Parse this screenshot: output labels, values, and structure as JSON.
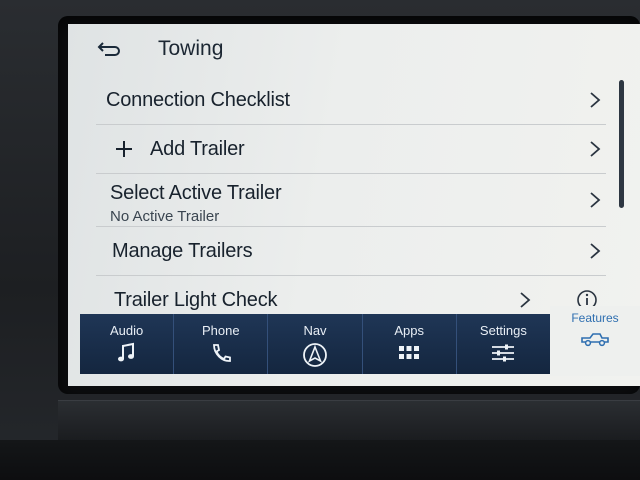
{
  "header": {
    "title": "Towing"
  },
  "menu": [
    {
      "label": "Connection Checklist"
    },
    {
      "label": "Add Trailer"
    },
    {
      "label": "Select Active Trailer",
      "sub": "No Active Trailer"
    },
    {
      "label": "Manage Trailers"
    },
    {
      "label": "Trailer Light Check"
    }
  ],
  "nav": [
    {
      "label": "Audio",
      "icon": "music-note-icon"
    },
    {
      "label": "Phone",
      "icon": "phone-icon"
    },
    {
      "label": "Nav",
      "icon": "navigation-arrow-icon"
    },
    {
      "label": "Apps",
      "icon": "grid-icon"
    },
    {
      "label": "Settings",
      "icon": "sliders-icon"
    }
  ],
  "features": {
    "label": "Features",
    "icon": "truck-icon"
  },
  "colors": {
    "nav_bg": "#1f3656",
    "accent": "#2f6fb0",
    "screen_bg": "#eceeed"
  }
}
